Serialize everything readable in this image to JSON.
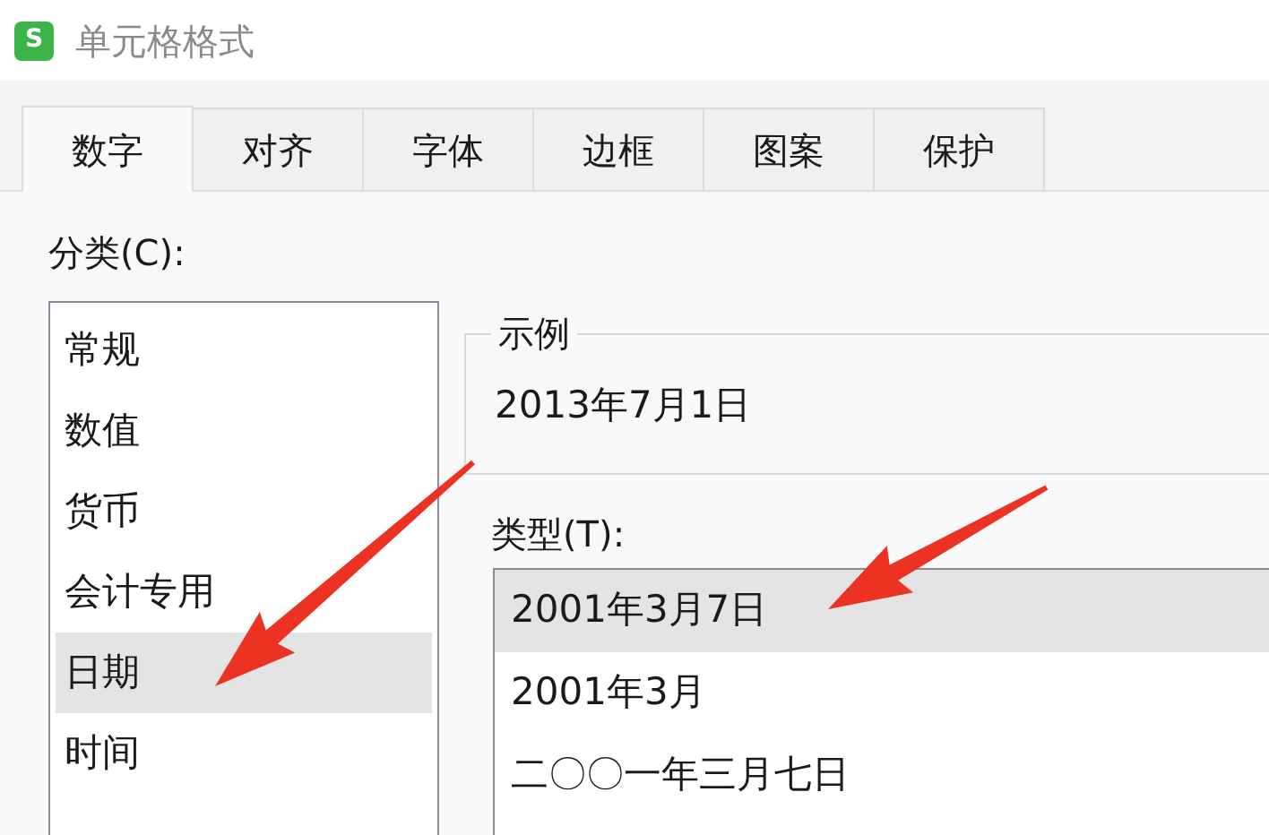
{
  "window": {
    "title": "单元格格式",
    "app_icon": "S"
  },
  "tabs": [
    {
      "label": "数字",
      "selected": true
    },
    {
      "label": "对齐",
      "selected": false
    },
    {
      "label": "字体",
      "selected": false
    },
    {
      "label": "边框",
      "selected": false
    },
    {
      "label": "图案",
      "selected": false
    },
    {
      "label": "保护",
      "selected": false
    }
  ],
  "category": {
    "label": "分类(C):",
    "items": [
      {
        "label": "常规",
        "selected": false
      },
      {
        "label": "数值",
        "selected": false
      },
      {
        "label": "货币",
        "selected": false
      },
      {
        "label": "会计专用",
        "selected": false
      },
      {
        "label": "日期",
        "selected": true
      },
      {
        "label": "时间",
        "selected": false
      }
    ]
  },
  "sample": {
    "legend": "示例",
    "value": "2013年7月1日"
  },
  "type": {
    "label": "类型(T):",
    "items": [
      {
        "label": "2001年3月7日",
        "selected": true
      },
      {
        "label": "2001年3月",
        "selected": false
      },
      {
        "label": "二〇〇一年三月七日",
        "selected": false
      }
    ]
  }
}
